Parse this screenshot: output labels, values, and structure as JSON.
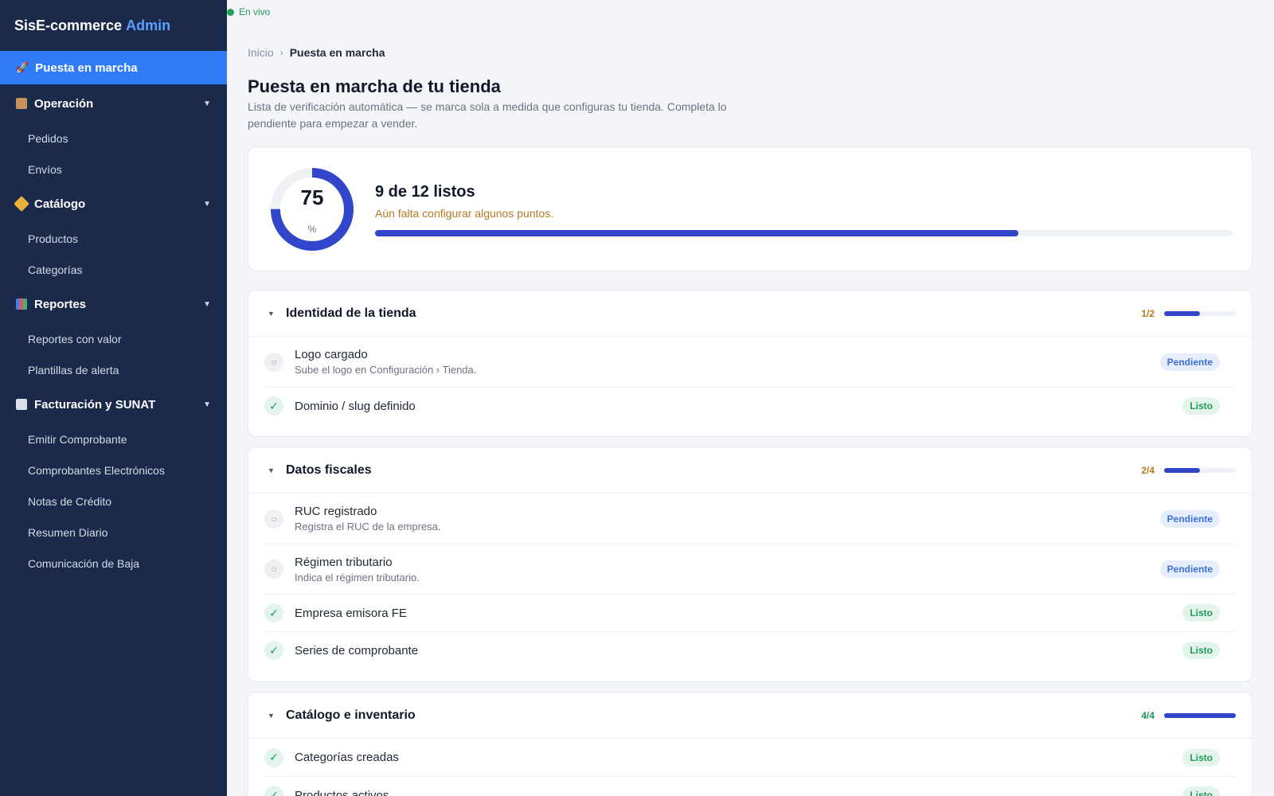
{
  "sidebar": {
    "brand": "SisE-commerce",
    "brand_accent": "Admin",
    "active_item": {
      "icon": "rocket-icon",
      "label": "Puesta en marcha"
    },
    "groups": [
      {
        "icon": "package-icon",
        "label": "Operación",
        "items": [
          "Pedidos",
          "Envíos"
        ]
      },
      {
        "icon": "tag-icon",
        "label": "Catálogo",
        "items": [
          "Productos",
          "Categorías"
        ]
      },
      {
        "icon": "chart-icon",
        "label": "Reportes",
        "items": [
          "Reportes con valor",
          "Plantillas de alerta"
        ]
      },
      {
        "icon": "receipt-icon",
        "label": "Facturación y SUNAT",
        "items": [
          "Emitir Comprobante",
          "Comprobantes Electrónicos",
          "Notas de Crédito",
          "Resumen Diario",
          "Comunicación de Baja"
        ]
      }
    ]
  },
  "header": {
    "live_status": "En vivo",
    "breadcrumb": {
      "root": "Inicio",
      "separator": "›",
      "current": "Puesta en marcha"
    },
    "title": "Puesta en marcha de tu tienda",
    "subtitle": "Lista de verificación automática — se marca sola a medida que configuras tu tienda. Completa lo pendiente para empezar a vender."
  },
  "summary": {
    "percent": 75,
    "percent_value": "75",
    "percent_unit": "%",
    "title": "9 de 12 listos",
    "note": "Aún falta configurar algunos puntos.",
    "progress": 0.75
  },
  "sections": [
    {
      "title": "Identidad de la tienda",
      "count": "1/2",
      "progress": 0.5,
      "count_color": "#b7791f",
      "items": [
        {
          "label": "Logo cargado",
          "hint": "Sube el logo en Configuración › Tienda.",
          "status": "pending",
          "badge": "Pendiente"
        },
        {
          "label": "Dominio / slug definido",
          "hint": "",
          "status": "done",
          "badge": "Listo"
        }
      ]
    },
    {
      "title": "Datos fiscales",
      "count": "2/4",
      "progress": 0.5,
      "count_color": "#b7791f",
      "items": [
        {
          "label": "RUC registrado",
          "hint": "Registra el RUC de la empresa.",
          "status": "pending",
          "badge": "Pendiente"
        },
        {
          "label": "Régimen tributario",
          "hint": "Indica el régimen tributario.",
          "status": "pending",
          "badge": "Pendiente"
        },
        {
          "label": "Empresa emisora FE",
          "hint": "",
          "status": "done",
          "badge": "Listo"
        },
        {
          "label": "Series de comprobante",
          "hint": "",
          "status": "done",
          "badge": "Listo"
        }
      ]
    },
    {
      "title": "Catálogo e inventario",
      "count": "4/4",
      "progress": 1.0,
      "count_color": "#1f9a5a",
      "items": [
        {
          "label": "Categorías creadas",
          "hint": "",
          "status": "done",
          "badge": "Listo"
        },
        {
          "label": "Productos activos",
          "hint": "",
          "status": "done",
          "badge": "Listo"
        }
      ]
    }
  ],
  "colors": {
    "sidebar_bg": "#1b2a4a",
    "active": "#2f7cf6",
    "accent": "#3146c9",
    "pending": "#3b6fd8",
    "done": "#1f9a5a",
    "warn": "#b7791f"
  }
}
